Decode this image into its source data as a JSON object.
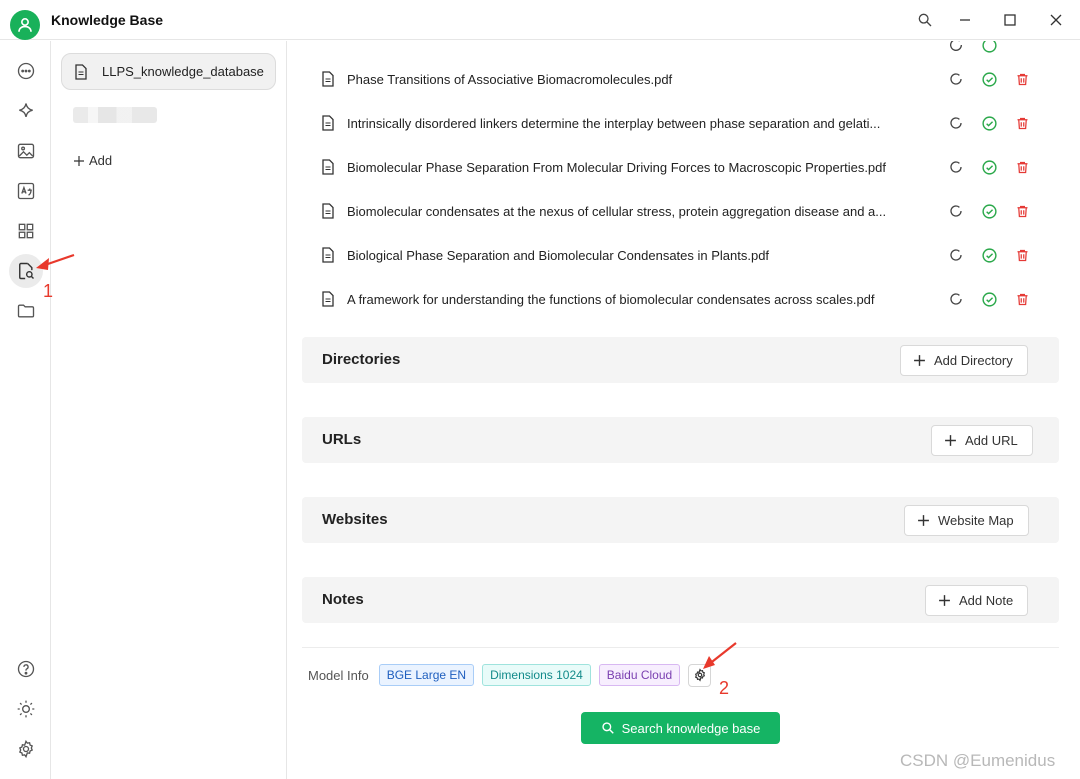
{
  "app": {
    "title": "Knowledge Base"
  },
  "knowledge_bases": {
    "items": [
      {
        "label": "LLPS_knowledge_database"
      }
    ],
    "add_label": "Add"
  },
  "files": [
    {
      "name": "Phase Transitions of Associative Biomacromolecules.pdf"
    },
    {
      "name": "Intrinsically disordered linkers determine the interplay between phase separation and gelati..."
    },
    {
      "name": "Biomolecular Phase Separation From Molecular Driving Forces to Macroscopic Properties.pdf"
    },
    {
      "name": "Biomolecular condensates at the nexus of cellular stress, protein aggregation disease and a..."
    },
    {
      "name": "Biological Phase Separation and Biomolecular Condensates in Plants.pdf"
    },
    {
      "name": "A framework for understanding the functions of biomolecular condensates across scales.pdf"
    }
  ],
  "sections": {
    "directories": {
      "title": "Directories",
      "button": "Add Directory"
    },
    "urls": {
      "title": "URLs",
      "button": "Add URL"
    },
    "websites": {
      "title": "Websites",
      "button": "Website Map"
    },
    "notes": {
      "title": "Notes",
      "button": "Add Note"
    }
  },
  "model_info": {
    "label": "Model Info",
    "tags": [
      "BGE Large EN",
      "Dimensions 1024",
      "Baidu Cloud"
    ]
  },
  "search_button": "Search knowledge base",
  "annotations": {
    "one": "1",
    "two": "2"
  },
  "watermark": "CSDN @Eumenidus",
  "colors": {
    "accent": "#15b464",
    "success": "#2aa84a",
    "danger": "#e53935",
    "annotation": "#e8392c"
  }
}
